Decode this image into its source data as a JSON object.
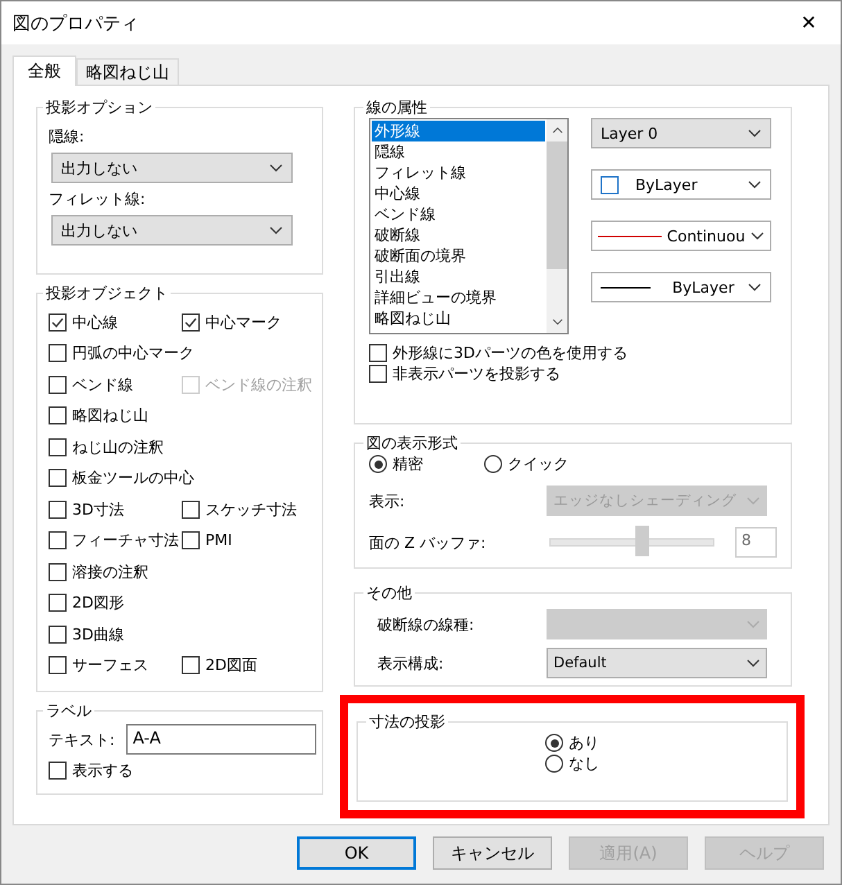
{
  "window": {
    "title": "図のプロパティ",
    "close": "✕"
  },
  "tabs": [
    {
      "label": "全般",
      "selected": true
    },
    {
      "label": "略図ねじ山",
      "selected": false
    }
  ],
  "projection_options": {
    "title": "投影オプション",
    "fields": [
      {
        "label": "隠線:",
        "value": "出力しない"
      },
      {
        "label": "フィレット線:",
        "value": "出力しない"
      }
    ]
  },
  "projection_objects": {
    "title": "投影オブジェクト",
    "rows": [
      [
        {
          "label": "中心線",
          "checked": true,
          "disabled": false
        },
        {
          "label": "中心マーク",
          "checked": true,
          "disabled": false
        }
      ],
      [
        {
          "label": "円弧の中心マーク",
          "checked": false,
          "disabled": false
        }
      ],
      [
        {
          "label": "ベンド線",
          "checked": false,
          "disabled": false
        },
        {
          "label": "ベンド線の注釈",
          "checked": false,
          "disabled": true
        }
      ],
      [
        {
          "label": "略図ねじ山",
          "checked": false,
          "disabled": false
        }
      ],
      [
        {
          "label": "ねじ山の注釈",
          "checked": false,
          "disabled": false
        }
      ],
      [
        {
          "label": "板金ツールの中心",
          "checked": false,
          "disabled": false
        }
      ],
      [
        {
          "label": "3D寸法",
          "checked": false,
          "disabled": false
        },
        {
          "label": "スケッチ寸法",
          "checked": false,
          "disabled": false
        }
      ],
      [
        {
          "label": "フィーチャ寸法",
          "checked": false,
          "disabled": false
        },
        {
          "label": "PMI",
          "checked": false,
          "disabled": false
        }
      ],
      [
        {
          "label": "溶接の注釈",
          "checked": false,
          "disabled": false
        }
      ],
      [
        {
          "label": "2D図形",
          "checked": false,
          "disabled": false
        }
      ],
      [
        {
          "label": "3D曲線",
          "checked": false,
          "disabled": false
        }
      ],
      [
        {
          "label": "サーフェス",
          "checked": false,
          "disabled": false
        },
        {
          "label": "2D図面",
          "checked": false,
          "disabled": false
        }
      ]
    ]
  },
  "label_group": {
    "title": "ラベル",
    "text_label": "テキスト:",
    "text_value": "A-A",
    "show": {
      "label": "表示する",
      "checked": false
    }
  },
  "line_properties": {
    "title": "線の属性",
    "items": [
      {
        "label": "外形線",
        "selected": true
      },
      {
        "label": "隠線",
        "selected": false
      },
      {
        "label": "フィレット線",
        "selected": false
      },
      {
        "label": "中心線",
        "selected": false
      },
      {
        "label": "ベンド線",
        "selected": false
      },
      {
        "label": "破断線",
        "selected": false
      },
      {
        "label": "破断面の境界",
        "selected": false
      },
      {
        "label": "引出線",
        "selected": false
      },
      {
        "label": "詳細ビューの境界",
        "selected": false
      },
      {
        "label": "略図ねじ山",
        "selected": false
      }
    ],
    "layer": "Layer 0",
    "color_setting": "ByLayer",
    "linetype": "Continuou",
    "weight": "ByLayer",
    "options": [
      {
        "label": "外形線に3Dパーツの色を使用する",
        "checked": false
      },
      {
        "label": "非表示パーツを投影する",
        "checked": false
      }
    ]
  },
  "display_style": {
    "title": "図の表示形式",
    "radios": [
      {
        "label": "精密",
        "selected": true
      },
      {
        "label": "クイック",
        "selected": false
      }
    ],
    "display": {
      "label": "表示:",
      "value": "エッジなしシェーディング",
      "disabled": true
    },
    "zbuffer": {
      "label": "面の Z バッファ:",
      "level": 0.57,
      "value": "8",
      "disabled": true
    }
  },
  "other": {
    "title": "その他",
    "fields": [
      {
        "label": "破断線の線種:",
        "disabled": true
      },
      {
        "label": "表示構成:",
        "value": "Default",
        "disabled": false
      }
    ]
  },
  "dimension_projection": {
    "title": "寸法の投影",
    "highlighted": true,
    "radios": [
      {
        "label": "あり",
        "selected": true
      },
      {
        "label": "なし",
        "selected": false
      }
    ]
  },
  "buttons": [
    {
      "label": "OK",
      "disabled": false,
      "default": true
    },
    {
      "label": "キャンセル",
      "disabled": false,
      "default": false
    },
    {
      "label": "適用(A)",
      "disabled": true,
      "default": false
    },
    {
      "label": "ヘルプ",
      "disabled": true,
      "default": false
    }
  ]
}
